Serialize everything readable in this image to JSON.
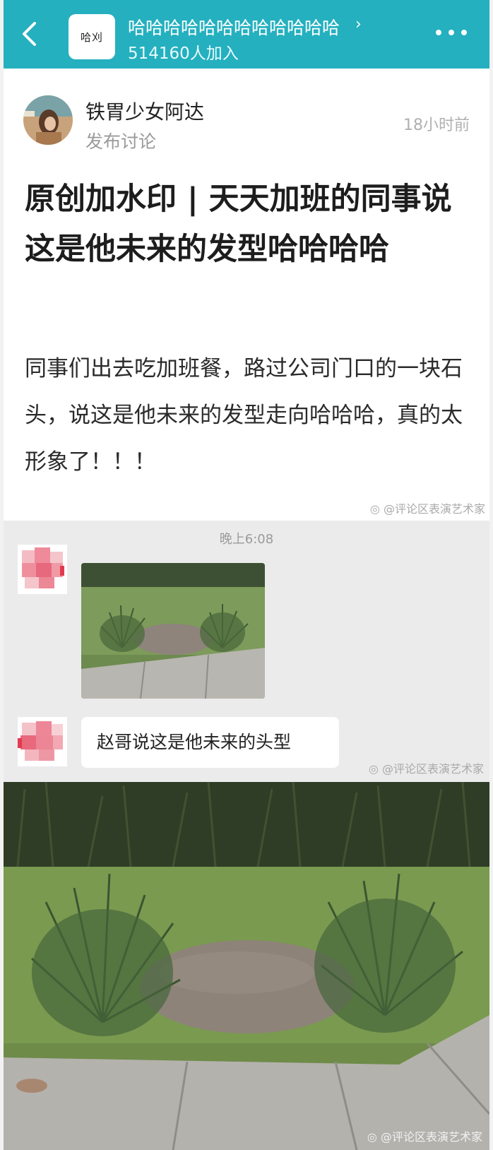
{
  "header": {
    "group_logo_text": "哈刈",
    "group_name": "哈哈哈哈哈哈哈哈哈哈哈哈",
    "members": "514160人加入",
    "icons": [
      "back-arrow-icon",
      "chevron-right-icon",
      "more-dots-icon"
    ]
  },
  "post": {
    "author": "铁胃少女阿达",
    "action": "发布讨论",
    "time": "18小时前",
    "title": "原创加水印 | 天天加班的同事说这是他未来的发型哈哈哈哈",
    "body": "同事们出去吃加班餐，路过公司门口的一块石头，说这是他未来的发型走向哈哈哈，真的太形象了！！！"
  },
  "watermark": "@评论区表演艺术家",
  "chat": {
    "timestamp": "晚上6:08",
    "message": "赵哥说这是他未来的头型"
  },
  "colors": {
    "accent": "#24b0bf",
    "chat_bg": "#ebebeb",
    "text_dark": "#1d1d1d",
    "text_muted": "#9a9a9a"
  }
}
